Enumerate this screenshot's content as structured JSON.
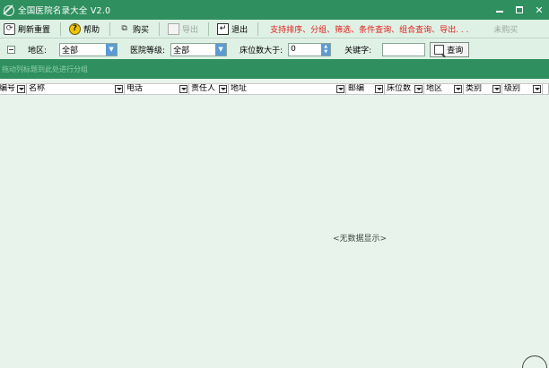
{
  "window": {
    "title": "全国医院名录大全 V2.0",
    "min_glyph": "",
    "max_glyph": "",
    "close_glyph": "✕"
  },
  "toolbar": {
    "refresh_label": "刷新重置",
    "help_label": "帮助",
    "buy_label": "购买",
    "export_label": "导出",
    "exit_label": "退出",
    "promo_text": "支持排序、分组、筛选、条件查询、组合查询、导出. . .",
    "unregistered_label": "未购买"
  },
  "filters": {
    "region_label": "地区:",
    "region_value": "全部",
    "level_label": "医院等级:",
    "level_value": "全部",
    "beds_label": "床位数大于:",
    "beds_value": "0",
    "keyword_label": "关键字:",
    "keyword_value": "",
    "query_label": "查询"
  },
  "group_panel": {
    "hint": "拖动列标题到此处进行分组"
  },
  "grid": {
    "columns": [
      "编号",
      "名称",
      "电话",
      "责任人",
      "地址",
      "邮编",
      "床位数",
      "地区",
      "类别",
      "级别",
      ""
    ],
    "empty_text": "<无数据显示>"
  },
  "colors": {
    "titlebar": "#2f8f5f",
    "toolbar_bg": "#dff0e5",
    "body_bg": "#e8f3ec",
    "promo_red": "#e1201b",
    "combo_arrow_blue": "#5a9bd5"
  },
  "icons": [
    "app-icon",
    "refresh-icon",
    "help-icon",
    "buy-icon",
    "export-icon",
    "exit-icon",
    "search-icon",
    "dropdown-arrow-icon"
  ]
}
